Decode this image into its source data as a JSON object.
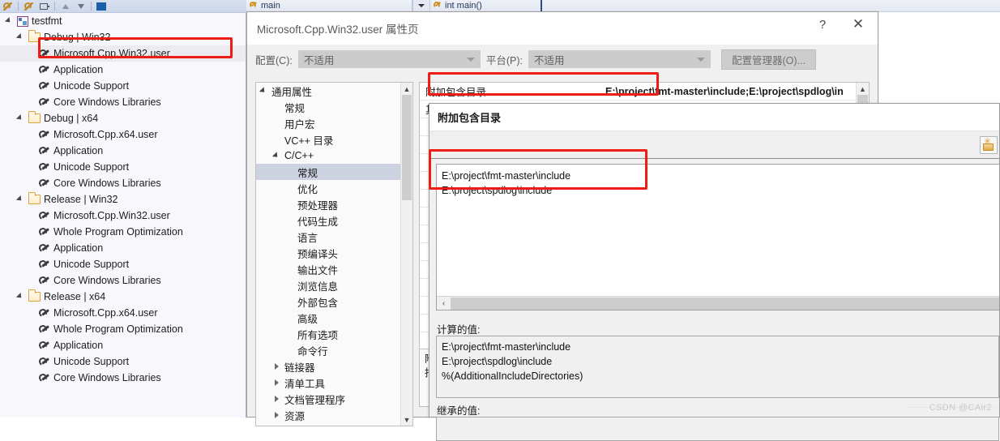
{
  "toolbar": {
    "icons": [
      "wrench-icon",
      "wrench-icon",
      "properties-icon",
      "move-up-icon",
      "move-down-icon",
      "blue-block-icon"
    ]
  },
  "editor_nav": {
    "scope_label": "main",
    "member_label": "int main()"
  },
  "property_manager": {
    "root": {
      "label": "testfmt",
      "icon": "project-icon"
    },
    "groups": [
      {
        "label": "Debug | Win32",
        "items": [
          {
            "label": "Microsoft.Cpp.Win32.user",
            "selected": true
          },
          {
            "label": "Application",
            "selected": false
          },
          {
            "label": "Unicode Support",
            "selected": false
          },
          {
            "label": "Core Windows Libraries",
            "selected": false
          }
        ]
      },
      {
        "label": "Debug | x64",
        "items": [
          {
            "label": "Microsoft.Cpp.x64.user",
            "selected": false
          },
          {
            "label": "Application",
            "selected": false
          },
          {
            "label": "Unicode Support",
            "selected": false
          },
          {
            "label": "Core Windows Libraries",
            "selected": false
          }
        ]
      },
      {
        "label": "Release | Win32",
        "items": [
          {
            "label": "Microsoft.Cpp.Win32.user",
            "selected": false
          },
          {
            "label": "Whole Program Optimization",
            "selected": false
          },
          {
            "label": "Application",
            "selected": false
          },
          {
            "label": "Unicode Support",
            "selected": false
          },
          {
            "label": "Core Windows Libraries",
            "selected": false
          }
        ]
      },
      {
        "label": "Release | x64",
        "items": [
          {
            "label": "Microsoft.Cpp.x64.user",
            "selected": false
          },
          {
            "label": "Whole Program Optimization",
            "selected": false
          },
          {
            "label": "Application",
            "selected": false
          },
          {
            "label": "Unicode Support",
            "selected": false
          },
          {
            "label": "Core Windows Libraries",
            "selected": false
          }
        ]
      }
    ]
  },
  "dialog": {
    "title": "Microsoft.Cpp.Win32.user 属性页",
    "help_glyph": "?",
    "close_glyph": "✕",
    "config_label": "配置(C):",
    "config_value": "不适用",
    "platform_label": "平台(P):",
    "platform_value": "不适用",
    "config_manager_button": "配置管理器(O)...",
    "tree": [
      {
        "label": "通用属性",
        "indent": 0,
        "twisty": "open",
        "selected": false
      },
      {
        "label": "常规",
        "indent": 1,
        "twisty": "none",
        "selected": false
      },
      {
        "label": "用户宏",
        "indent": 1,
        "twisty": "none",
        "selected": false
      },
      {
        "label": "VC++ 目录",
        "indent": 1,
        "twisty": "none",
        "selected": false
      },
      {
        "label": "C/C++",
        "indent": 1,
        "twisty": "open",
        "selected": false
      },
      {
        "label": "常规",
        "indent": 2,
        "twisty": "none",
        "selected": true
      },
      {
        "label": "优化",
        "indent": 2,
        "twisty": "none",
        "selected": false
      },
      {
        "label": "预处理器",
        "indent": 2,
        "twisty": "none",
        "selected": false
      },
      {
        "label": "代码生成",
        "indent": 2,
        "twisty": "none",
        "selected": false
      },
      {
        "label": "语言",
        "indent": 2,
        "twisty": "none",
        "selected": false
      },
      {
        "label": "预编译头",
        "indent": 2,
        "twisty": "none",
        "selected": false
      },
      {
        "label": "输出文件",
        "indent": 2,
        "twisty": "none",
        "selected": false
      },
      {
        "label": "浏览信息",
        "indent": 2,
        "twisty": "none",
        "selected": false
      },
      {
        "label": "外部包含",
        "indent": 2,
        "twisty": "none",
        "selected": false
      },
      {
        "label": "高级",
        "indent": 2,
        "twisty": "none",
        "selected": false
      },
      {
        "label": "所有选项",
        "indent": 2,
        "twisty": "none",
        "selected": false
      },
      {
        "label": "命令行",
        "indent": 2,
        "twisty": "none",
        "selected": false
      },
      {
        "label": "链接器",
        "indent": 1,
        "twisty": "closed",
        "selected": false
      },
      {
        "label": "清单工具",
        "indent": 1,
        "twisty": "closed",
        "selected": false
      },
      {
        "label": "文档管理程序",
        "indent": 1,
        "twisty": "closed",
        "selected": false
      },
      {
        "label": "资源",
        "indent": 1,
        "twisty": "closed",
        "selected": false
      }
    ],
    "grid_rows": [
      {
        "name": "附加包含目录",
        "value": "E:\\project\\fmt-master\\include;E:\\project\\spdlog\\in"
      },
      {
        "name": "其他 #using 搜索",
        "value": ""
      }
    ],
    "description": {
      "line1": "附加包含目录",
      "line2": "指定一个或多个要添加到包含路径的目录"
    }
  },
  "sub_dialog": {
    "title": "附加包含目录",
    "new_folder_button": "new-folder-icon",
    "entries": [
      "E:\\project\\fmt-master\\include",
      "E:\\project\\spdlog\\include"
    ],
    "hscroll_left_glyph": "‹",
    "evaluated_label": "计算的值:",
    "evaluated_lines": [
      "E:\\project\\fmt-master\\include",
      "E:\\project\\spdlog\\include",
      "%(AdditionalIncludeDirectories)"
    ],
    "inherited_label": "继承的值:",
    "inherited_lines": []
  },
  "watermark": "CSDN @CAir2",
  "colors": {
    "annotation": "#ee1c12",
    "selection": "#cdd2e0",
    "accent": "#2b4d8e"
  }
}
